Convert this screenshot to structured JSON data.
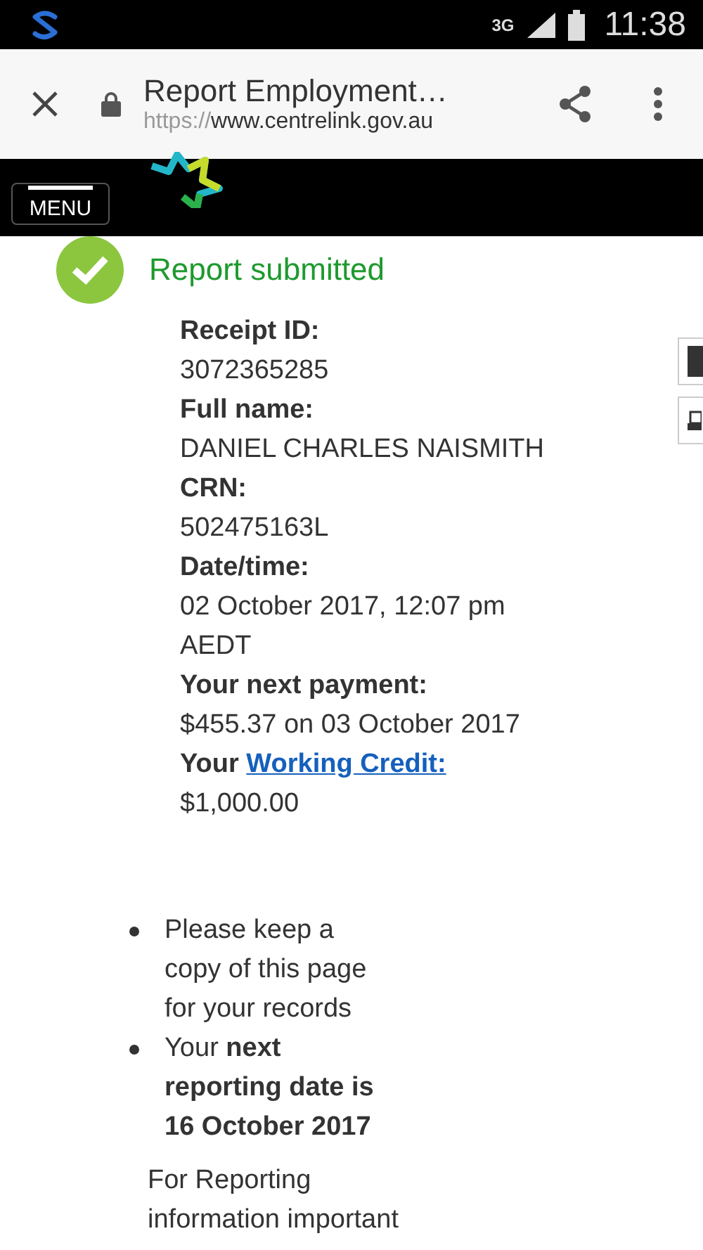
{
  "status_bar": {
    "network": "3G",
    "time": "11:38"
  },
  "browser": {
    "title": "Report Employment…",
    "url_scheme": "https://",
    "url_host": "www.centrelink.gov.au"
  },
  "site_header": {
    "menu_label": "MENU"
  },
  "heading": "Report submitted",
  "details": [
    {
      "kind": "label",
      "text": "Receipt ID:"
    },
    {
      "kind": "value",
      "text": "3072365285"
    },
    {
      "kind": "label",
      "text": "Full name:"
    },
    {
      "kind": "value",
      "text": "DANIEL CHARLES NAISMITH"
    },
    {
      "kind": "label",
      "text": "CRN:"
    },
    {
      "kind": "value",
      "text": "502475163L"
    },
    {
      "kind": "label",
      "text": "Date/time:"
    },
    {
      "kind": "value",
      "text": "02 October 2017, 12:07 pm AEDT"
    },
    {
      "kind": "label",
      "text": "Your next payment:"
    },
    {
      "kind": "value",
      "text": "$455.37 on 03 October 2017"
    },
    {
      "kind": "label_link",
      "text": "Your",
      "link": "Working Credit:"
    },
    {
      "kind": "value",
      "text": "$1,000.00"
    }
  ],
  "notes": [
    "Please keep a copy of this page for your records",
    "Your **next reporting date is 16 October 2017**"
  ],
  "footer_text": "For Reporting information important"
}
